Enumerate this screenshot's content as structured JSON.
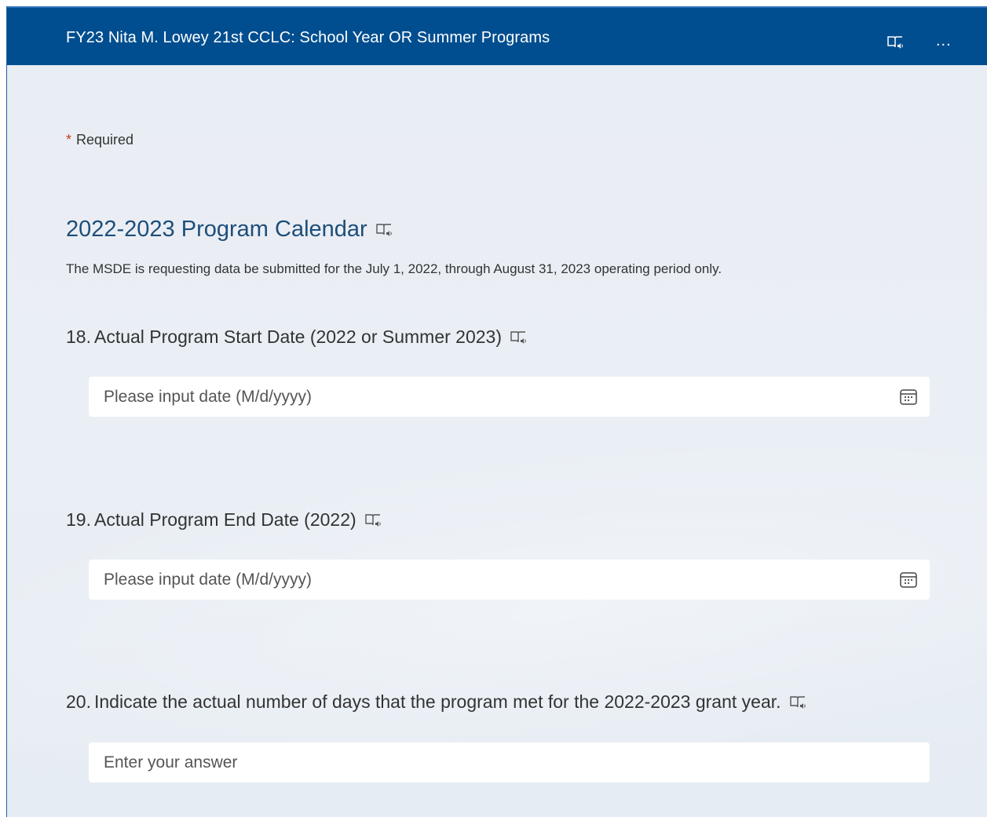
{
  "header": {
    "title": "FY23 Nita M. Lowey 21st CCLC: School Year OR Summer Programs",
    "reader_icon": "immersive-reader-icon",
    "more_label": "..."
  },
  "required_note": {
    "star": "*",
    "text": "Required"
  },
  "section": {
    "title": "2022-2023 Program Calendar",
    "description": "The MSDE is requesting data be submitted for the July 1, 2022, through August 31, 2023 operating period only."
  },
  "questions": [
    {
      "number": "18.",
      "text": "Actual Program Start Date (2022 or Summer 2023)",
      "placeholder": "Please input date (M/d/yyyy)",
      "icon": "calendar-icon"
    },
    {
      "number": "19.",
      "text": "Actual Program End Date (2022)",
      "placeholder": "Please input date (M/d/yyyy)",
      "icon": "calendar-icon"
    },
    {
      "number": "20.",
      "text": "Indicate the actual number of days that the program met for the 2022-2023 grant year.",
      "placeholder": "Enter your answer"
    }
  ],
  "colors": {
    "header_bg": "#004e8f",
    "accent_title": "#1e4e79",
    "required_star": "#c43e1c",
    "page_bg": "#e9eef4"
  }
}
